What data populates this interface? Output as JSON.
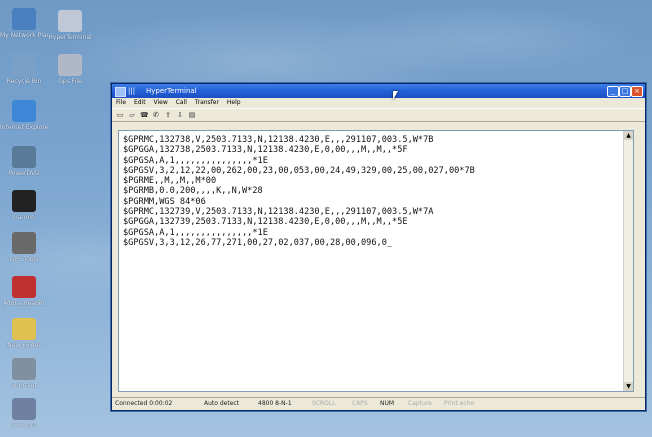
{
  "desktop": {
    "icons": [
      {
        "label": "My Network Places",
        "color": "#4a7fc0"
      },
      {
        "label": "Recycle Bin",
        "color": "#7aa0c8"
      },
      {
        "label": "Internet Explorer",
        "color": "#3d88d6"
      },
      {
        "label": "PowerDVD",
        "color": "#5a7a9a"
      },
      {
        "label": "Garmin",
        "color": "#222222"
      },
      {
        "label": "GPS Tools",
        "color": "#6a6a6a"
      },
      {
        "label": "Adobe Reader",
        "color": "#c03030"
      },
      {
        "label": "New Folder",
        "color": "#e0c050"
      },
      {
        "label": "Shortcut",
        "color": "#8090a0"
      },
      {
        "label": "GPS Info",
        "color": "#7080a0"
      },
      {
        "label": "HyperTerminal",
        "color": "#c0c8d8"
      },
      {
        "label": "Gps File",
        "color": "#b0b8c8"
      }
    ]
  },
  "window": {
    "title_prefix": "|||",
    "title": "HyperTerminal",
    "menu": [
      "File",
      "Edit",
      "View",
      "Call",
      "Transfer",
      "Help"
    ],
    "terminal_lines": [
      "$GPRMC,132738,V,2503.7133,N,12138.4230,E,,,291107,003.5,W*7B",
      "$GPGGA,132738,2503.7133,N,12138.4230,E,0,00,,,M,,M,,*5F",
      "$GPGSA,A,1,,,,,,,,,,,,,,,*1E",
      "$GPGSV,3,2,12,22,00,262,00,23,00,053,00,24,49,329,00,25,00,027,00*7B",
      "$PGRME,,M,,M,,M*00",
      "$PGRMB,0.0,200,,,,K,,N,W*28",
      "$PGRMM,WGS 84*06",
      "$GPRMC,132739,V,2503.7133,N,12138.4230,E,,,291107,003.5,W*7A",
      "$GPGGA,132739,2503.7133,N,12138.4230,E,0,00,,,M,,M,,*5E",
      "$GPGSA,A,1,,,,,,,,,,,,,,,*1E",
      "$GPGSV,3,3,12,26,77,271,00,27,02,037,00,28,00,096,0_"
    ],
    "status": {
      "connected": "Connected 0:00:02",
      "detect": "Auto detect",
      "params": "4800 8-N-1",
      "scroll": "SCROLL",
      "caps": "CAPS",
      "num": "NUM",
      "capture": "Capture",
      "print_echo": "Print echo"
    }
  }
}
